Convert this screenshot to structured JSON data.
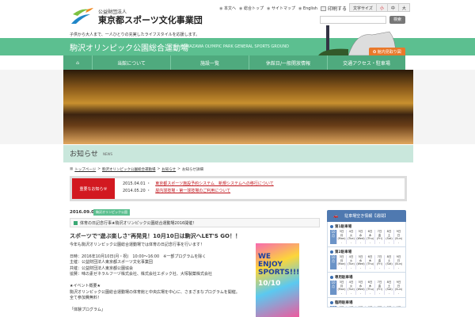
{
  "header": {
    "org_small": "公益財団法人",
    "org_name": "東京都スポーツ文化事業団",
    "util_links": [
      "本文へ",
      "総合トップ",
      "サイトマップ",
      "English"
    ],
    "print": "印刷する",
    "font_size_label": "文字サイズ",
    "font_sizes": [
      "小",
      "中",
      "大"
    ],
    "search_button": "検索",
    "search_value": "",
    "tagline": "子供から大人まで、一人ひとりの充実したライフスタイルを応援します。"
  },
  "site": {
    "title": "駒沢オリンピック公園総合運動場",
    "title_en": "KOMAZAWA OLYMPIC PARK GENERAL SPORTS GROUND",
    "map_button": "館内見取り図"
  },
  "nav": [
    "当館について",
    "施設一覧",
    "休館日/一般開放情報",
    "交通アクセス・駐車場"
  ],
  "page": {
    "heading": "お知らせ",
    "heading_en": "NEWS",
    "breadcrumb": [
      "トップページ",
      "駒沢オリンピック公園総合運動場",
      "お知らせ",
      "お知らせ詳細"
    ]
  },
  "notice": {
    "label": "重要なお知らせ",
    "items": [
      {
        "date": "2015.04.01",
        "text": "東京都スポーツ施設予約システム　新規システムへの移行について"
      },
      {
        "date": "2014.05.20",
        "text": "屋内球技場・第一球技場のご利用について"
      }
    ]
  },
  "news": {
    "date": "2016.09.01",
    "tag": "駒沢オリンピック公園",
    "title": "体育の日記念行事★駒沢オリンピック公園総合運動場2016開催！",
    "headline": "スポーツで\"遊ぶ楽しさ\"再発見！10月10日は駒沢へLET'S GO！！",
    "lines": [
      "今年も駒沢オリンピック公園総合運動場では体育の日記念行事を行います！",
      "",
      "日時：2016年10月10日(月・祝)　10:00～16:00　※一部プログラムを除く",
      "主催：公益財団法人東京都スポーツ文化事業団",
      "共催：公益財団法人東京都公園協会",
      "協賛：味の素ゼネラルフーヅ株式会社、株式会社エポック社、大塚製薬株式会社",
      "",
      "★イベント概要★",
      "駒沢オリンピック公園総合運動場の体育館と中央広場を中心に、さまざまなプログラムを開催。",
      "全て参加費無料！",
      "",
      "「体験プログラム」"
    ],
    "poster_text": "WE ENJOY SPORTS!!!",
    "poster_date": "10/10"
  },
  "parking": {
    "title": "駐車場空き情報【週間】",
    "month": "10月",
    "days": [
      {
        "d": "3日",
        "w": "月",
        "e": "(Mon)"
      },
      {
        "d": "4日",
        "w": "火",
        "e": "(Tue)"
      },
      {
        "d": "5日",
        "w": "水",
        "e": "(Wed)"
      },
      {
        "d": "6日",
        "w": "木",
        "e": "(Thu)"
      },
      {
        "d": "7日",
        "w": "金",
        "e": "(Fri)"
      },
      {
        "d": "8日",
        "w": "土",
        "e": "(Sat)"
      },
      {
        "d": "9日",
        "w": "日",
        "e": "(Sun)"
      }
    ],
    "lots": [
      "第1駐車場",
      "第2駐車場",
      "専用駐車場",
      "臨時駐車場"
    ],
    "status": "-"
  },
  "colors": {
    "green": "#5cbf90",
    "red": "#d21920",
    "blue": "#4f79b0",
    "orange": "#e9792b"
  }
}
